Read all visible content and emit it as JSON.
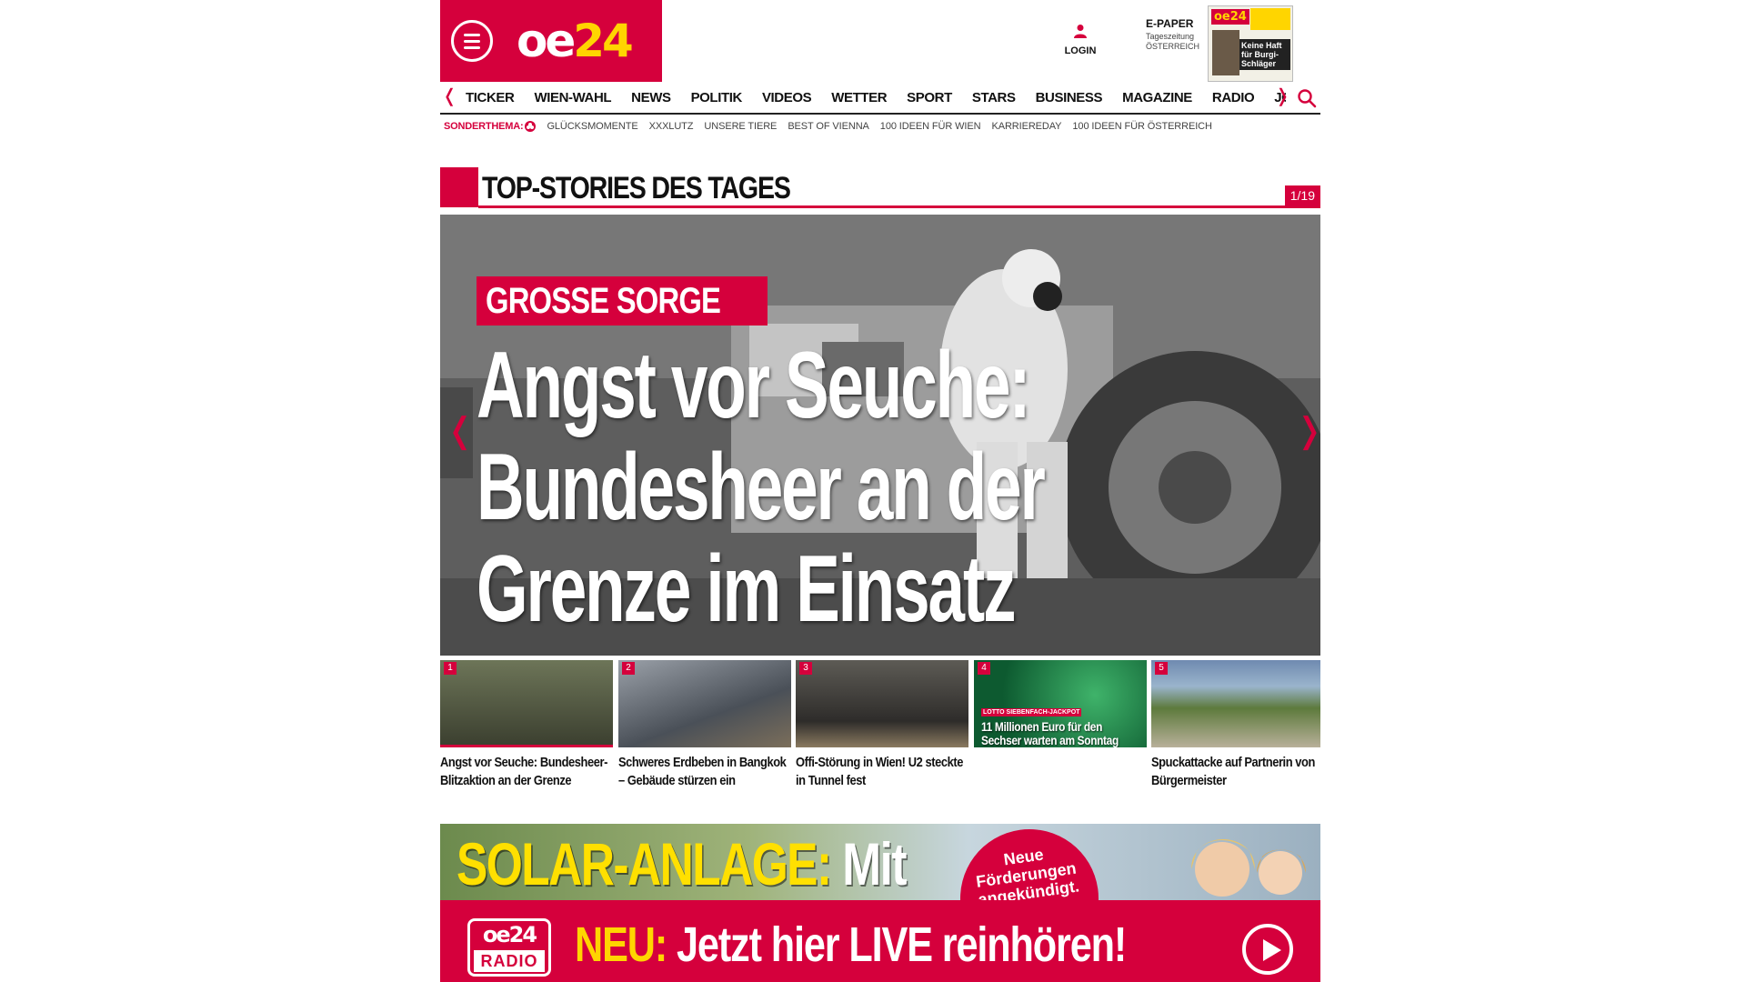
{
  "header": {
    "logo": {
      "part1": "oe",
      "part2": "24"
    },
    "login_label": "LOGIN",
    "epaper": {
      "title": "E-PAPER",
      "subtitle1": "Tageszeitung",
      "subtitle2": "ÖSTERREICH"
    },
    "cover": {
      "logo": "oe24",
      "headline": "Keine Haft für Burgi-Schläger"
    }
  },
  "nav": {
    "items": [
      "TICKER",
      "WIEN-WAHL",
      "NEWS",
      "POLITIK",
      "VIDEOS",
      "WETTER",
      "SPORT",
      "STARS",
      "BUSINESS",
      "MAGAZINE",
      "RADIO",
      "JOBS"
    ],
    "prev_arrow": "❬",
    "next_arrow": "❭"
  },
  "subnav": {
    "label": "SONDERTHEMA:",
    "items": [
      "GLÜCKSMOMENTE",
      "XXXLUTZ",
      "UNSERE TIERE",
      "BEST OF VIENNA",
      "100 IDEEN FÜR WIEN",
      "KARRIEREDAY",
      "100 IDEEN FÜR ÖSTERREICH"
    ]
  },
  "section": {
    "title": "TOP-STORIES DES TAGES",
    "counter": "1/19"
  },
  "hero": {
    "kicker": "GROSSE SORGE",
    "title": "Angst vor Seuche: Bundesheer an der Grenze im Einsatz",
    "prev_arrow": "❬",
    "next_arrow": "❭"
  },
  "teasers": [
    {
      "num": "1",
      "title": "Angst vor Seuche: Bundesheer-Blitzaktion an der Grenze"
    },
    {
      "num": "2",
      "title": "Schweres Erdbeben in Bangkok – Gebäude stürzen ein"
    },
    {
      "num": "3",
      "title": "Offi-Störung in Wien! U2 steckte in Tunnel fest"
    },
    {
      "num": "4",
      "title": "",
      "overlay_kicker": "LOTTO SIEBENFACH-JACKPOT",
      "overlay_title": "11 Millionen Euro für den Sechser warten am Sonntag"
    },
    {
      "num": "5",
      "title": "Spuckattacke auf Partnerin von Bürgermeister"
    }
  ],
  "ad": {
    "headline_highlight": "SOLAR-ANLAGE:",
    "headline_rest": "Mit",
    "badge_line1": "Neue",
    "badge_line2": "Förderungen",
    "badge_line3": "angekündigt."
  },
  "radio": {
    "logo_top": "oe24",
    "logo_bottom": "RADIO",
    "neu": "NEU:",
    "text": "Jetzt hier LIVE reinhören!"
  },
  "colors": {
    "brand_red": "#d5003c",
    "brand_yellow": "#ffd500"
  }
}
